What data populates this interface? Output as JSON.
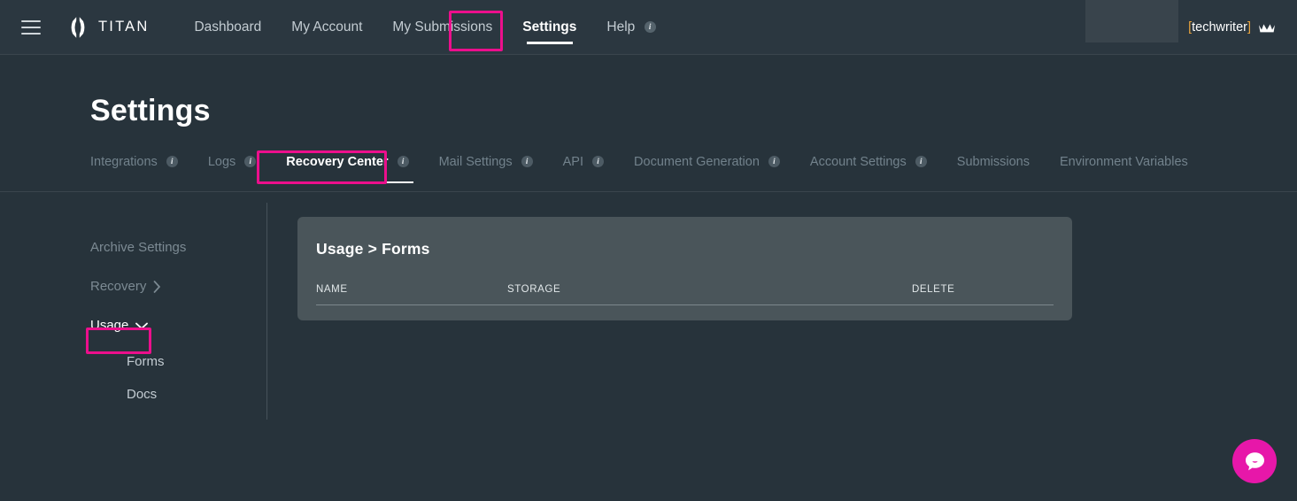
{
  "header": {
    "menu_icon": "hamburger-menu-icon",
    "brand": "TITAN",
    "nav": [
      {
        "label": "Dashboard",
        "active": false,
        "info": false
      },
      {
        "label": "My Account",
        "active": false,
        "info": false
      },
      {
        "label": "My Submissions",
        "active": false,
        "info": false
      },
      {
        "label": "Settings",
        "active": true,
        "info": false
      },
      {
        "label": "Help",
        "active": false,
        "info": true
      }
    ],
    "user": {
      "bracket_open": "[",
      "name": "techwriter",
      "bracket_close": "]",
      "badge_icon": "crown-icon"
    }
  },
  "page": {
    "title": "Settings"
  },
  "tabs": [
    {
      "label": "Integrations",
      "info": true,
      "active": false
    },
    {
      "label": "Logs",
      "info": true,
      "active": false
    },
    {
      "label": "Recovery Center",
      "info": true,
      "active": true
    },
    {
      "label": "Mail Settings",
      "info": true,
      "active": false
    },
    {
      "label": "API",
      "info": true,
      "active": false
    },
    {
      "label": "Document Generation",
      "info": true,
      "active": false
    },
    {
      "label": "Account Settings",
      "info": true,
      "active": false
    },
    {
      "label": "Submissions",
      "info": false,
      "active": false
    },
    {
      "label": "Environment Variables",
      "info": false,
      "active": false
    }
  ],
  "sidebar": {
    "items": [
      {
        "label": "Archive Settings",
        "chevron": "none",
        "selected": false
      },
      {
        "label": "Recovery",
        "chevron": "right",
        "selected": false
      },
      {
        "label": "Usage",
        "chevron": "down",
        "selected": true
      }
    ],
    "sub_items": [
      {
        "label": "Forms"
      },
      {
        "label": "Docs"
      }
    ]
  },
  "card": {
    "title": "Usage > Forms",
    "columns": [
      "NAME",
      "STORAGE",
      "DELETE"
    ],
    "rows": []
  },
  "chat": {
    "icon": "chat-bubble-icon"
  },
  "highlights": {
    "color": "#ec0f8c",
    "targets": [
      "Settings",
      "Recovery Center",
      "Usage"
    ]
  },
  "colors": {
    "accent_pink": "#ec0f8c",
    "page_bg": "#27333b",
    "header_bg": "#2b3740",
    "card_bg": "#4a555a",
    "chat_bg": "#e717a9",
    "bracket": "#e8a33d"
  }
}
